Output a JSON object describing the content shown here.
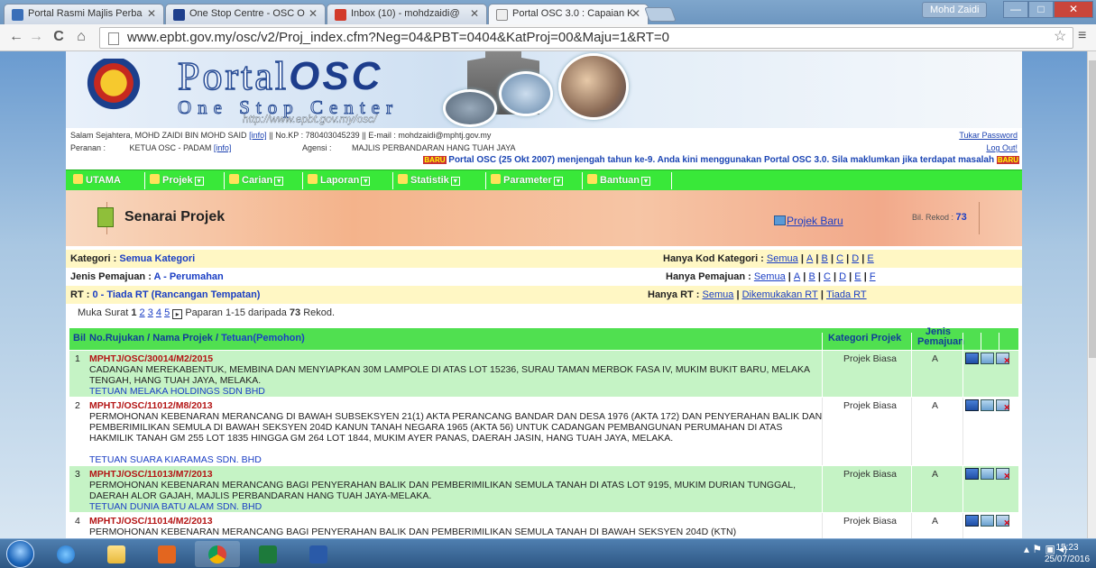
{
  "browser": {
    "tabs": [
      {
        "label": "Portal Rasmi Majlis Perba",
        "color": "#3a6fb8"
      },
      {
        "label": "One Stop Centre - OSC O",
        "color": "#1e3f8c"
      },
      {
        "label": "Inbox (10) - mohdzaidi@",
        "color": "#d23a2a"
      },
      {
        "label": "Portal OSC 3.0 : Capaian K",
        "color": "#eeeeee"
      }
    ],
    "tab_close": "✕",
    "user": "Mohd Zaidi",
    "win_min": "—",
    "win_max": "□",
    "win_close": "✕",
    "back": "←",
    "forward": "→",
    "reload": "C",
    "home": "⌂",
    "url": "www.epbt.gov.my/osc/v2/Proj_index.cfm?Neg=04&PBT=0404&KatProj=00&Maju=1&RT=0",
    "star": "☆",
    "menu": "≡"
  },
  "banner": {
    "logo_main": "Portal",
    "logo_osc": "OSC",
    "logo_sub": "One Stop Center",
    "logo_url": "http://www.epbt.gov.my/osc/"
  },
  "info": {
    "greeting": "Salam Sejahtera, MOHD ZAIDI BIN MOHD SAID",
    "info_link": "[info]",
    "kp": "|| No.KP : 780403045239 || E-mail : mohdzaidi@mphtj.gov.my",
    "peranan_label": "Peranan :",
    "peranan_value": "KETUA OSC - PADAM",
    "agensi_label": "Agensi :",
    "agensi_value": "MAJLIS PERBANDARAN HANG TUAH JAYA",
    "tukar_password": "Tukar Password",
    "log_out": "Log Out!",
    "new_badge": "BARU",
    "ticker": "Portal OSC (25 Okt 2007) menjengah tahun ke-9. Anda kini menggunakan Portal OSC 3.0. Sila maklumkan jika terdapat masalah"
  },
  "menu": [
    {
      "label": "UTAMA",
      "dd": false
    },
    {
      "label": "Projek",
      "dd": true
    },
    {
      "label": "Carian",
      "dd": true
    },
    {
      "label": "Laporan",
      "dd": true
    },
    {
      "label": "Statistik",
      "dd": true
    },
    {
      "label": "Parameter",
      "dd": true
    },
    {
      "label": "Bantuan",
      "dd": true
    }
  ],
  "menu_dd_glyph": "▾",
  "hero": {
    "title": "Senarai Projek",
    "baru": "Projek Baru",
    "rekod_label": "Bil. Rekod :",
    "rekod_value": "73"
  },
  "filters": {
    "kategori_label": "Kategori :",
    "kategori_value": "Semua Kategori",
    "kod_label": "Hanya Kod Kategori :",
    "kod_links": [
      "Semua",
      "A",
      "B",
      "C",
      "D",
      "E"
    ],
    "jenis_label": "Jenis Pemajuan :",
    "jenis_value": "A - Perumahan",
    "pemajuan_label": "Hanya Pemajuan :",
    "pemajuan_links": [
      "Semua",
      "A",
      "B",
      "C",
      "D",
      "E",
      "F"
    ],
    "rt_label": "RT :",
    "rt_value": "0 - Tiada RT (Rancangan Tempatan)",
    "hanya_rt_label": "Hanya RT :",
    "rt_links": [
      "Semua",
      "Dikemukakan RT",
      "Tiada RT"
    ],
    "sep": "|"
  },
  "pager": {
    "label": "Muka Surat",
    "pages": [
      "1",
      "2",
      "3",
      "4",
      "5"
    ],
    "next": "▸",
    "summary_a": "Paparan 1-15 daripada",
    "summary_count": "73",
    "summary_b": "Rekod."
  },
  "table": {
    "headers": {
      "bil": "Bil",
      "nama_a": "No.Rujukan / Nama Projek /",
      "nama_b": "Tetuan(Pemohon)",
      "kategori": "Kategori Projek",
      "jenis": "Jenis Pemajuan"
    },
    "rows": [
      {
        "no": "1",
        "code": "MPHTJ/OSC/30014/M2/2015",
        "desc": "CADANGAN MEREKABENTUK, MEMBINA DAN MENYIAPKAN 30M LAMPOLE DI ATAS LOT 15236, SURAU TAMAN MERBOK FASA IV, MUKIM BUKIT BARU, MELAKA TENGAH, HANG TUAH JAYA, MELAKA.",
        "tetuan": "TETUAN MELAKA HOLDINGS SDN BHD",
        "kategori": "Projek Biasa",
        "jenis": "A"
      },
      {
        "no": "2",
        "code": "MPHTJ/OSC/11012/M8/2013",
        "desc": "PERMOHONAN KEBENARAN MERANCANG DI BAWAH SUBSEKSYEN 21(1) AKTA PERANCANG BANDAR DAN DESA 1976 (AKTA 172) DAN PENYERAHAN BALIK DAN PEMBERIMILIKAN SEMULA DI BAWAH SEKSYEN 204D KANUN TANAH NEGARA 1965 (AKTA 56) UNTUK CADANGAN PEMBANGUNAN PERUMAHAN DI ATAS HAKMILIK TANAH GM 255 LOT 1835 HINGGA GM 264 LOT 1844, MUKIM AYER PANAS, DAERAH JASIN, HANG TUAH JAYA, MELAKA.",
        "tetuan": "TETUAN SUARA KIARAMAS SDN. BHD",
        "kategori": "Projek Biasa",
        "jenis": "A"
      },
      {
        "no": "3",
        "code": "MPHTJ/OSC/11013/M7/2013",
        "desc": "PERMOHONAN KEBENARAN MERANCANG BAGI PENYERAHAN BALIK DAN PEMBERIMILIKAN SEMULA TANAH DI ATAS LOT 9195, MUKIM DURIAN TUNGGAL, DAERAH ALOR GAJAH, MAJLIS PERBANDARAN HANG TUAH JAYA-MELAKA.",
        "tetuan": "TETUAN DUNIA BATU ALAM SDN. BHD",
        "kategori": "Projek Biasa",
        "jenis": "A"
      },
      {
        "no": "4",
        "code": "MPHTJ/OSC/11014/M2/2013",
        "desc": "PERMOHONAN KEBENARAN MERANCANG BAGI PENYERAHAN BALIK DAN PEMBERIMILIKAN SEMULA TANAH DI BAWAH SEKSYEN 204D (KTN)",
        "tetuan": "",
        "kategori": "Projek Biasa",
        "jenis": "A"
      }
    ]
  },
  "taskbar": {
    "time": "15:23",
    "date": "25/07/2016"
  }
}
